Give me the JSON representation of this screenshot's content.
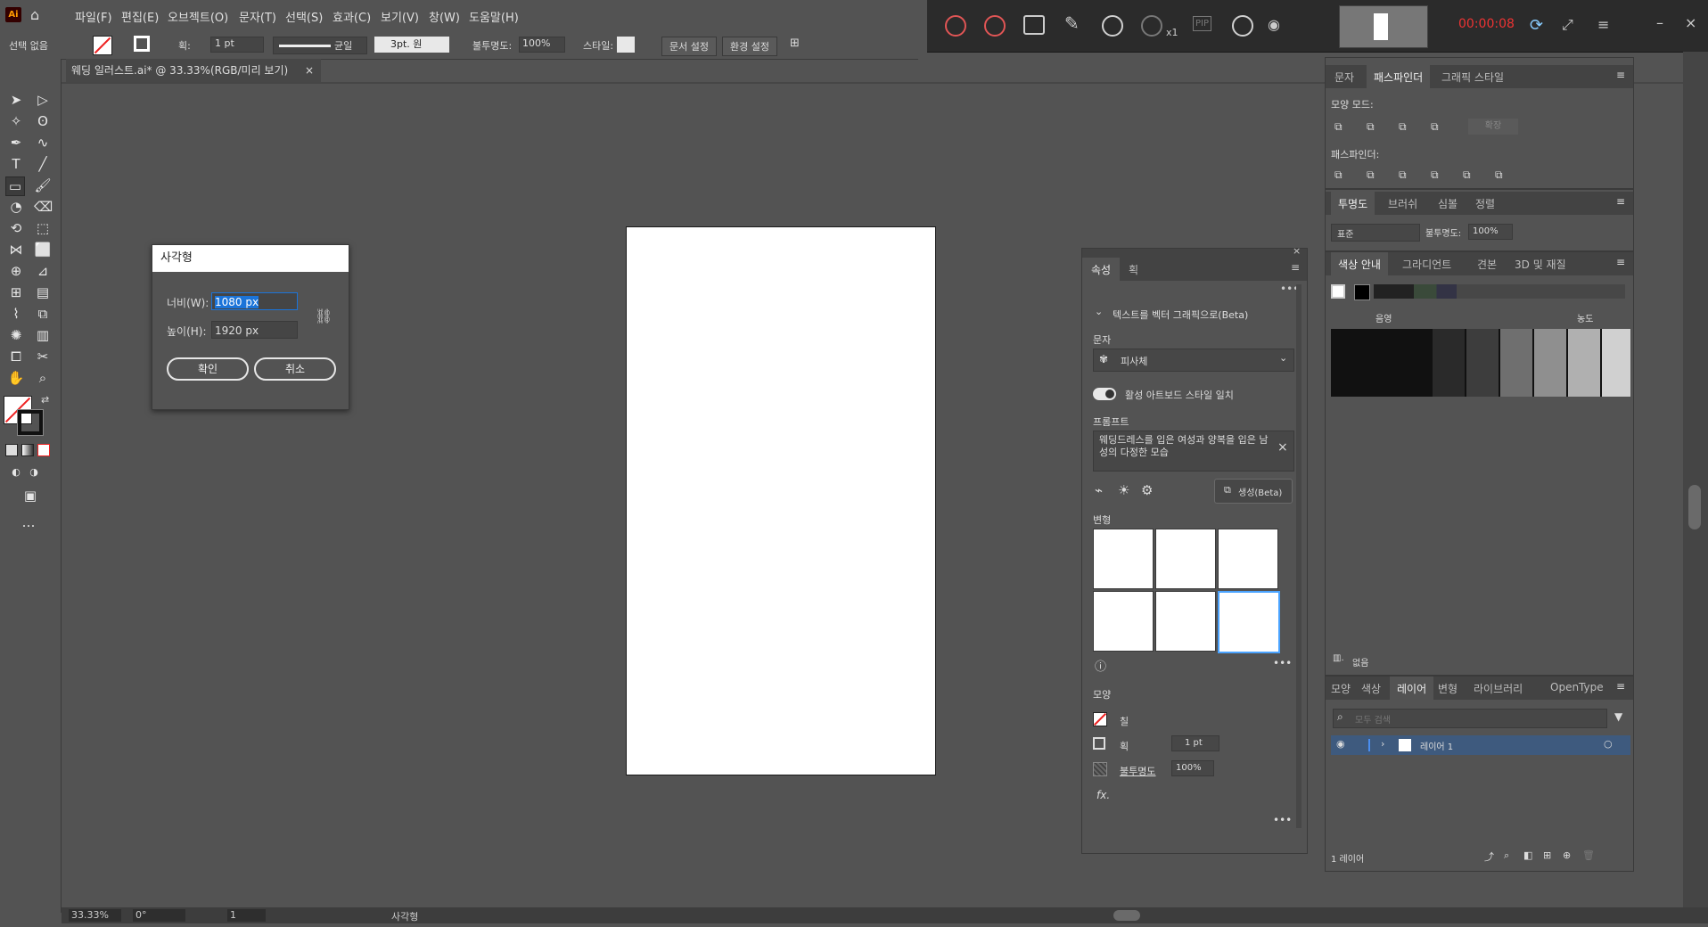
{
  "app": {
    "logo": "Ai",
    "home_icon": "home-icon"
  },
  "menu": [
    "파일(F)",
    "편집(E)",
    "오브젝트(O)",
    "문자(T)",
    "선택(S)",
    "효과(C)",
    "보기(V)",
    "창(W)",
    "도움말(H)"
  ],
  "control": {
    "selection": "선택 없음",
    "stroke_label": "획:",
    "stroke_value": "1 pt",
    "profile_label": "균일",
    "brush_value": "3pt. 원",
    "opacity_label": "불투명도:",
    "opacity_value": "100%",
    "style_label": "스타일:",
    "doc_setup": "문서 설정",
    "prefs": "환경 설정"
  },
  "recorder": {
    "timer": "00:00:08",
    "zoom": "x1",
    "pip": "PIP"
  },
  "document_tab": {
    "title": "웨딩 일러스트.ai* @ 33.33%(RGB/미리 보기)",
    "close": "×"
  },
  "dialog": {
    "title": "사각형",
    "width_label": "너비(W):",
    "width_value": "1080 px",
    "height_label": "높이(H):",
    "height_value": "1920 px",
    "ok": "확인",
    "cancel": "취소"
  },
  "props_panel": {
    "tabs": [
      "속성",
      "획"
    ],
    "section": "텍스트를 벡터 그래픽으로(Beta)",
    "type_label": "문자",
    "type_value": "피사체",
    "toggle_label": "활성 아트보드 스타일 일치",
    "prompt_label": "프롬프트",
    "prompt_text": "웨딩드레스를 입은 여성과 양복을 입은 남성의 다정한 모습",
    "generate": "생성(Beta)",
    "variations_label": "변형",
    "appearance_label": "모양",
    "fill_label": "칠",
    "stroke_label": "획",
    "stroke_value": "1 pt",
    "opacity_label": "불투명도",
    "opacity_value": "100%",
    "fx": "fx."
  },
  "pathfinder": {
    "tabs": [
      "문자",
      "패스파인더",
      "그래픽 스타일"
    ],
    "shape_modes": "모양 모드:",
    "expand": "확장",
    "pathfinders": "패스파인더:"
  },
  "transparency": {
    "tabs": [
      "투명도",
      "브러쉬",
      "심볼",
      "정렬"
    ],
    "mode": "표준",
    "opacity_label": "불투명도:",
    "opacity_value": "100%"
  },
  "color_guide": {
    "tabs": [
      "색상 안내",
      "그라디언트",
      "견본",
      "3D 및 재질"
    ],
    "shade_label": "음영",
    "tint_label": "농도",
    "footer": "없음",
    "colors": {
      "c1": "#000000",
      "c2": "#141414",
      "c3": "#2a2a2a",
      "c4": "#3d3d3d",
      "c5": "#6f6f6f",
      "c6": "#8f8f8f",
      "c7": "#b0b0b0",
      "c8": "#d0d0d0"
    }
  },
  "layers": {
    "tabs": [
      "모양",
      "색상",
      "레이어",
      "변형",
      "라이브러리",
      "OpenType"
    ],
    "search_placeholder": "모두 검색",
    "layer_name": "레이어 1",
    "count": "1 레이어"
  },
  "status": {
    "zoom": "33.33%",
    "rotation": "0°",
    "page": "1",
    "tool": "사각형"
  }
}
